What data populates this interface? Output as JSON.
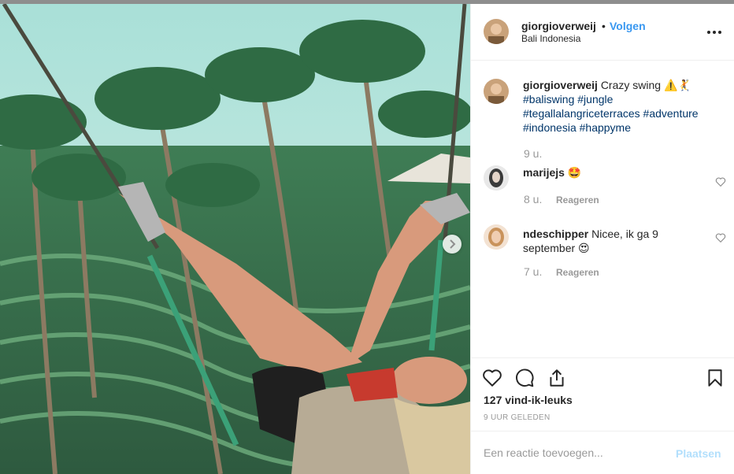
{
  "post": {
    "username": "giorgioverweij",
    "dot": "•",
    "follow_label": "Volgen",
    "location": "Bali Indonesia",
    "more_icon": "more-options-icon",
    "photo_description_icon": "photo",
    "next_icon": "chevron-right-icon"
  },
  "caption": {
    "username": "giorgioverweij",
    "text": "Crazy swing ⚠️🤾",
    "hashtags": [
      "#baliswing",
      "#jungle",
      "#tegallalangriceterraces",
      "#adventure",
      "#indonesia",
      "#happyme"
    ],
    "time": "9 u."
  },
  "comments": [
    {
      "username": "marijejs",
      "text": "🤩",
      "time": "8 u.",
      "reply_label": "Reageren"
    },
    {
      "username": "ndeschipper",
      "text": "Nicee, ik ga 9 september 😍",
      "time": "7 u.",
      "reply_label": "Reageren"
    }
  ],
  "actions": {
    "like_icon": "heart-icon",
    "comment_icon": "comment-icon",
    "share_icon": "share-icon",
    "save_icon": "bookmark-icon"
  },
  "likes": "127 vind-ik-leuks",
  "posted_ago": "9 UUR GELEDEN",
  "comment_box": {
    "placeholder": "Een reactie toevoegen...",
    "post_label": "Plaatsen"
  },
  "colors": {
    "link_blue": "#3897f0",
    "hashtag": "#003569",
    "muted": "#999999",
    "post_disabled": "#b2dffc"
  }
}
